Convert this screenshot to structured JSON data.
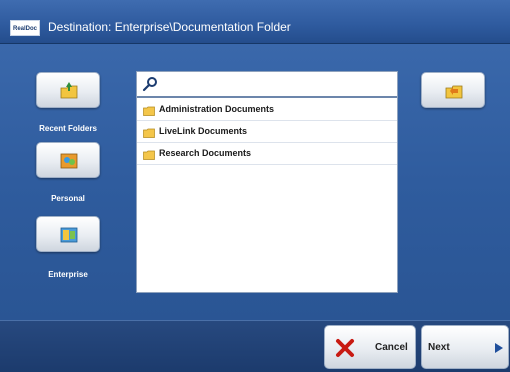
{
  "header": {
    "logo_text": "RealDoc",
    "title": "Destination: Enterprise\\Documentation Folder"
  },
  "sidebar": {
    "items": [
      {
        "label": "Recent Folders",
        "icon": "recent-folders-icon"
      },
      {
        "label": "Personal",
        "icon": "personal-icon"
      },
      {
        "label": "Enterprise",
        "icon": "enterprise-icon"
      }
    ]
  },
  "browser": {
    "search": {
      "value": "",
      "icon": "search-icon"
    },
    "folders": [
      {
        "name": "Administration Documents",
        "icon": "folder-icon"
      },
      {
        "name": "LiveLink Documents",
        "icon": "folder-icon"
      },
      {
        "name": "Research Documents",
        "icon": "folder-icon"
      }
    ],
    "up_icon": "folder-up-icon"
  },
  "footer": {
    "cancel_label": "Cancel",
    "cancel_icon": "cross-icon",
    "next_label": "Next",
    "next_icon": "arrow-right-icon"
  },
  "colors": {
    "background": "#2f5c9e",
    "titlebar": "#2e5a9e",
    "folder": "#f4c64a",
    "cancel_x": "#c81a12",
    "next_arrow": "#1f4f9c"
  }
}
